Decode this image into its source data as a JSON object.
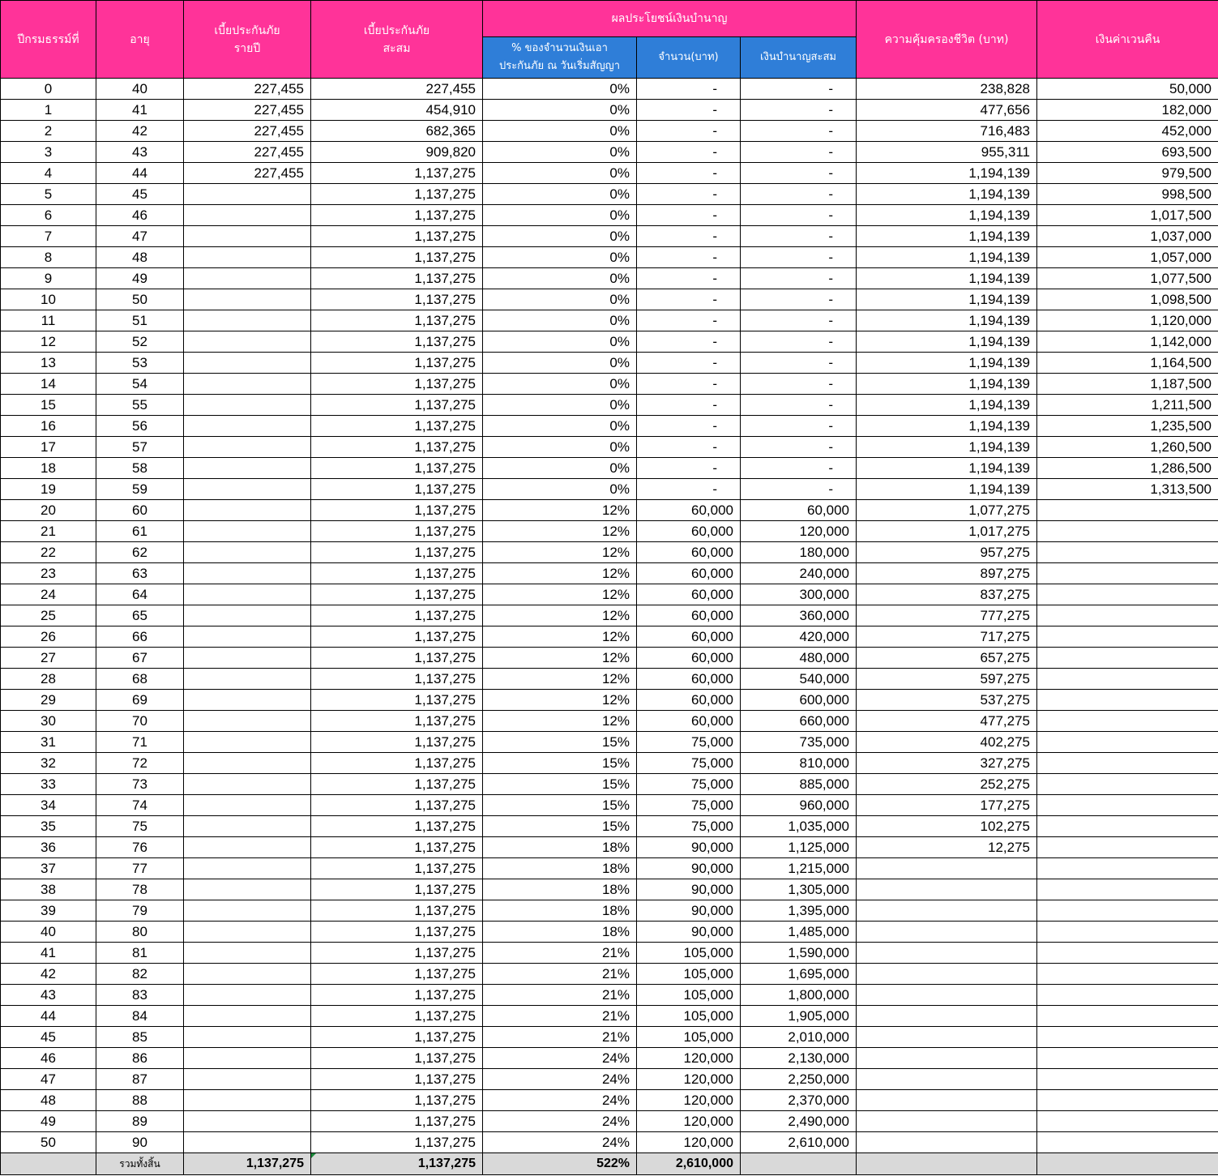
{
  "headers": {
    "year": "ปีกรมธรรม์ที่",
    "age": "อายุ",
    "annual_premium": [
      "เบี้ยประกันภัย",
      "รายปี"
    ],
    "cum_premium": [
      "เบี้ยประกันภัย",
      "สะสม"
    ],
    "pension_group": "ผลประโยชน์เงินบำนาญ",
    "pension_pct": [
      "% ของจำนวนเงินเอา",
      "ประกันภัย ณ วันเริ่มสัญญา"
    ],
    "pension_amount": "จำนวน(บาท)",
    "pension_cum": "เงินบำนาญสะสม",
    "coverage": "ความคุ้มครองชีวิต (บาท)",
    "surrender": "เงินค่าเวนคืน"
  },
  "rows": [
    [
      "0",
      "40",
      "227,455",
      "227,455",
      "0%",
      "-",
      "-",
      "238,828",
      "50,000"
    ],
    [
      "1",
      "41",
      "227,455",
      "454,910",
      "0%",
      "-",
      "-",
      "477,656",
      "182,000"
    ],
    [
      "2",
      "42",
      "227,455",
      "682,365",
      "0%",
      "-",
      "-",
      "716,483",
      "452,000"
    ],
    [
      "3",
      "43",
      "227,455",
      "909,820",
      "0%",
      "-",
      "-",
      "955,311",
      "693,500"
    ],
    [
      "4",
      "44",
      "227,455",
      "1,137,275",
      "0%",
      "-",
      "-",
      "1,194,139",
      "979,500"
    ],
    [
      "5",
      "45",
      "",
      "1,137,275",
      "0%",
      "-",
      "-",
      "1,194,139",
      "998,500"
    ],
    [
      "6",
      "46",
      "",
      "1,137,275",
      "0%",
      "-",
      "-",
      "1,194,139",
      "1,017,500"
    ],
    [
      "7",
      "47",
      "",
      "1,137,275",
      "0%",
      "-",
      "-",
      "1,194,139",
      "1,037,000"
    ],
    [
      "8",
      "48",
      "",
      "1,137,275",
      "0%",
      "-",
      "-",
      "1,194,139",
      "1,057,000"
    ],
    [
      "9",
      "49",
      "",
      "1,137,275",
      "0%",
      "-",
      "-",
      "1,194,139",
      "1,077,500"
    ],
    [
      "10",
      "50",
      "",
      "1,137,275",
      "0%",
      "-",
      "-",
      "1,194,139",
      "1,098,500"
    ],
    [
      "11",
      "51",
      "",
      "1,137,275",
      "0%",
      "-",
      "-",
      "1,194,139",
      "1,120,000"
    ],
    [
      "12",
      "52",
      "",
      "1,137,275",
      "0%",
      "-",
      "-",
      "1,194,139",
      "1,142,000"
    ],
    [
      "13",
      "53",
      "",
      "1,137,275",
      "0%",
      "-",
      "-",
      "1,194,139",
      "1,164,500"
    ],
    [
      "14",
      "54",
      "",
      "1,137,275",
      "0%",
      "-",
      "-",
      "1,194,139",
      "1,187,500"
    ],
    [
      "15",
      "55",
      "",
      "1,137,275",
      "0%",
      "-",
      "-",
      "1,194,139",
      "1,211,500"
    ],
    [
      "16",
      "56",
      "",
      "1,137,275",
      "0%",
      "-",
      "-",
      "1,194,139",
      "1,235,500"
    ],
    [
      "17",
      "57",
      "",
      "1,137,275",
      "0%",
      "-",
      "-",
      "1,194,139",
      "1,260,500"
    ],
    [
      "18",
      "58",
      "",
      "1,137,275",
      "0%",
      "-",
      "-",
      "1,194,139",
      "1,286,500"
    ],
    [
      "19",
      "59",
      "",
      "1,137,275",
      "0%",
      "-",
      "-",
      "1,194,139",
      "1,313,500"
    ],
    [
      "20",
      "60",
      "",
      "1,137,275",
      "12%",
      "60,000",
      "60,000",
      "1,077,275",
      ""
    ],
    [
      "21",
      "61",
      "",
      "1,137,275",
      "12%",
      "60,000",
      "120,000",
      "1,017,275",
      ""
    ],
    [
      "22",
      "62",
      "",
      "1,137,275",
      "12%",
      "60,000",
      "180,000",
      "957,275",
      ""
    ],
    [
      "23",
      "63",
      "",
      "1,137,275",
      "12%",
      "60,000",
      "240,000",
      "897,275",
      ""
    ],
    [
      "24",
      "64",
      "",
      "1,137,275",
      "12%",
      "60,000",
      "300,000",
      "837,275",
      ""
    ],
    [
      "25",
      "65",
      "",
      "1,137,275",
      "12%",
      "60,000",
      "360,000",
      "777,275",
      ""
    ],
    [
      "26",
      "66",
      "",
      "1,137,275",
      "12%",
      "60,000",
      "420,000",
      "717,275",
      ""
    ],
    [
      "27",
      "67",
      "",
      "1,137,275",
      "12%",
      "60,000",
      "480,000",
      "657,275",
      ""
    ],
    [
      "28",
      "68",
      "",
      "1,137,275",
      "12%",
      "60,000",
      "540,000",
      "597,275",
      ""
    ],
    [
      "29",
      "69",
      "",
      "1,137,275",
      "12%",
      "60,000",
      "600,000",
      "537,275",
      ""
    ],
    [
      "30",
      "70",
      "",
      "1,137,275",
      "12%",
      "60,000",
      "660,000",
      "477,275",
      ""
    ],
    [
      "31",
      "71",
      "",
      "1,137,275",
      "15%",
      "75,000",
      "735,000",
      "402,275",
      ""
    ],
    [
      "32",
      "72",
      "",
      "1,137,275",
      "15%",
      "75,000",
      "810,000",
      "327,275",
      ""
    ],
    [
      "33",
      "73",
      "",
      "1,137,275",
      "15%",
      "75,000",
      "885,000",
      "252,275",
      ""
    ],
    [
      "34",
      "74",
      "",
      "1,137,275",
      "15%",
      "75,000",
      "960,000",
      "177,275",
      ""
    ],
    [
      "35",
      "75",
      "",
      "1,137,275",
      "15%",
      "75,000",
      "1,035,000",
      "102,275",
      ""
    ],
    [
      "36",
      "76",
      "",
      "1,137,275",
      "18%",
      "90,000",
      "1,125,000",
      "12,275",
      ""
    ],
    [
      "37",
      "77",
      "",
      "1,137,275",
      "18%",
      "90,000",
      "1,215,000",
      "",
      ""
    ],
    [
      "38",
      "78",
      "",
      "1,137,275",
      "18%",
      "90,000",
      "1,305,000",
      "",
      ""
    ],
    [
      "39",
      "79",
      "",
      "1,137,275",
      "18%",
      "90,000",
      "1,395,000",
      "",
      ""
    ],
    [
      "40",
      "80",
      "",
      "1,137,275",
      "18%",
      "90,000",
      "1,485,000",
      "",
      ""
    ],
    [
      "41",
      "81",
      "",
      "1,137,275",
      "21%",
      "105,000",
      "1,590,000",
      "",
      ""
    ],
    [
      "42",
      "82",
      "",
      "1,137,275",
      "21%",
      "105,000",
      "1,695,000",
      "",
      ""
    ],
    [
      "43",
      "83",
      "",
      "1,137,275",
      "21%",
      "105,000",
      "1,800,000",
      "",
      ""
    ],
    [
      "44",
      "84",
      "",
      "1,137,275",
      "21%",
      "105,000",
      "1,905,000",
      "",
      ""
    ],
    [
      "45",
      "85",
      "",
      "1,137,275",
      "21%",
      "105,000",
      "2,010,000",
      "",
      ""
    ],
    [
      "46",
      "86",
      "",
      "1,137,275",
      "24%",
      "120,000",
      "2,130,000",
      "",
      ""
    ],
    [
      "47",
      "87",
      "",
      "1,137,275",
      "24%",
      "120,000",
      "2,250,000",
      "",
      ""
    ],
    [
      "48",
      "88",
      "",
      "1,137,275",
      "24%",
      "120,000",
      "2,370,000",
      "",
      ""
    ],
    [
      "49",
      "89",
      "",
      "1,137,275",
      "24%",
      "120,000",
      "2,490,000",
      "",
      ""
    ],
    [
      "50",
      "90",
      "",
      "1,137,275",
      "24%",
      "120,000",
      "2,610,000",
      "",
      ""
    ]
  ],
  "totals": {
    "label": "รวมทั้งสิ้น",
    "annual_premium": "1,137,275",
    "cum_premium": "1,137,275",
    "pension_pct": "522%",
    "pension_amount": "2,610,000"
  }
}
